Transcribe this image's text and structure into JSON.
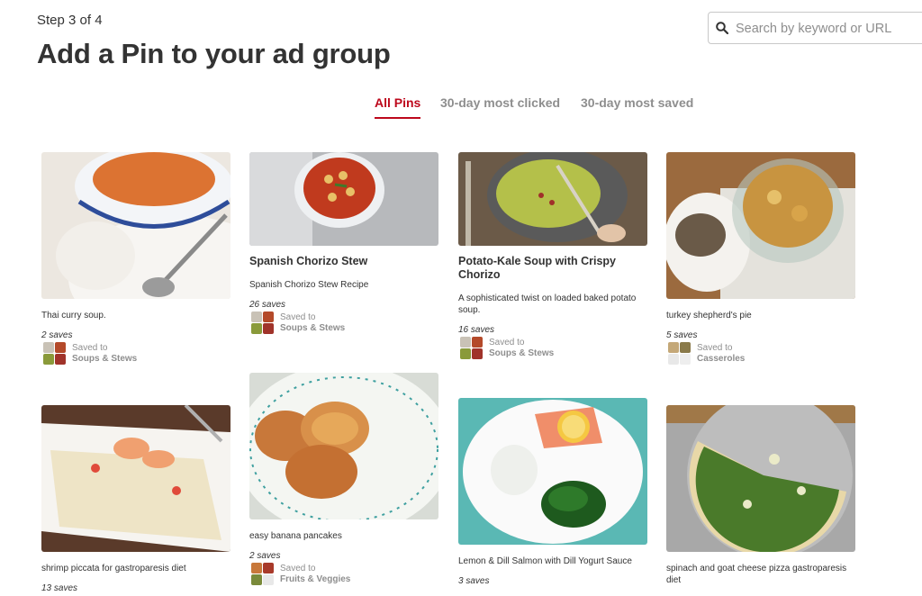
{
  "header": {
    "step": "Step 3 of 4",
    "title": "Add a Pin to your ad group"
  },
  "search": {
    "placeholder": "Search by keyword or URL",
    "value": ""
  },
  "tabs": [
    {
      "label": "All Pins",
      "active": true
    },
    {
      "label": "30-day most clicked",
      "active": false
    },
    {
      "label": "30-day most saved",
      "active": false
    }
  ],
  "colors": {
    "accent": "#bd081c",
    "text": "#333333",
    "muted": "#8e8e8e"
  },
  "saved_to_label": "Saved to",
  "pins": [
    {
      "title": "",
      "description": "Thai curry soup.",
      "saves": "2 saves",
      "board": "Soups & Stews"
    },
    {
      "title": "Spanish Chorizo Stew",
      "description": "Spanish Chorizo Stew Recipe",
      "saves": "26 saves",
      "board": "Soups & Stews"
    },
    {
      "title": "Potato-Kale Soup with Crispy Chorizo",
      "description": "A sophisticated twist on loaded baked potato soup.",
      "saves": "16 saves",
      "board": "Soups & Stews"
    },
    {
      "title": "",
      "description": "turkey shepherd's pie",
      "saves": "5 saves",
      "board": "Casseroles"
    },
    {
      "title": "",
      "description": "shrimp piccata for gastroparesis diet",
      "saves": "13 saves",
      "board": ""
    },
    {
      "title": "",
      "description": "easy banana pancakes",
      "saves": "2 saves",
      "board": "Fruits & Veggies"
    },
    {
      "title": "",
      "description": "Lemon & Dill Salmon with Dill Yogurt Sauce",
      "saves": "3 saves",
      "board": ""
    },
    {
      "title": "",
      "description": "spinach and goat cheese pizza gastroparesis diet",
      "saves": "",
      "board": ""
    }
  ]
}
